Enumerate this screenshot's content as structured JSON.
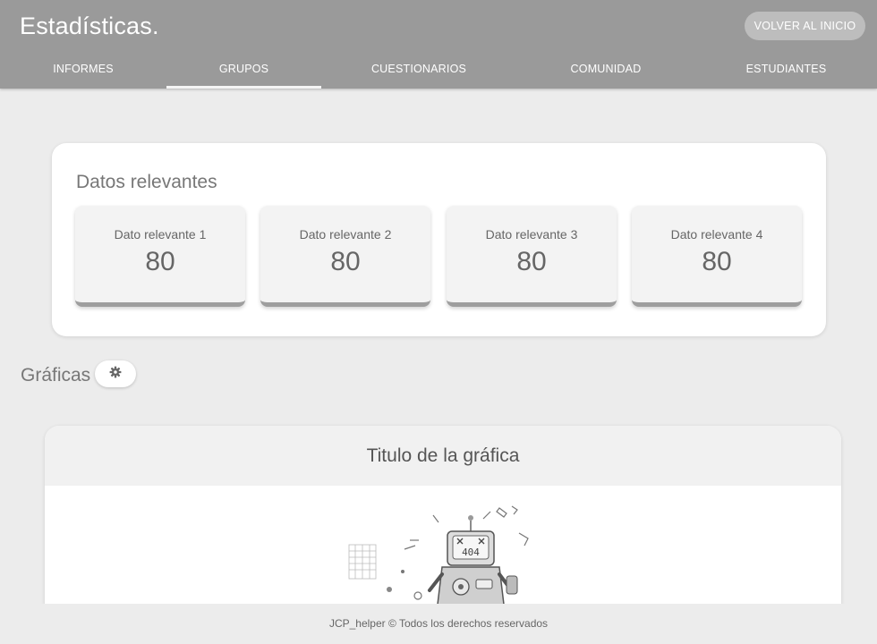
{
  "header": {
    "title": "Estadísticas.",
    "home_button": "VOLVER AL INICIO",
    "tabs": [
      {
        "label": "INFORMES"
      },
      {
        "label": "GRUPOS"
      },
      {
        "label": "CUESTIONARIOS"
      },
      {
        "label": "COMUNIDAD"
      },
      {
        "label": "ESTUDIANTES"
      }
    ],
    "active_tab": "GRUPOS"
  },
  "relevant": {
    "title": "Datos relevantes",
    "stats": [
      {
        "label": "Dato relevante 1",
        "value": "80"
      },
      {
        "label": "Dato relevante 2",
        "value": "80"
      },
      {
        "label": "Dato relevante 3",
        "value": "80"
      },
      {
        "label": "Dato relevante 4",
        "value": "80"
      }
    ]
  },
  "charts": {
    "title": "Gráficas",
    "settings_icon": "gear-icon",
    "card_title": "Titulo de la gráfica",
    "placeholder_screen_text": "404",
    "placeholder_icon": "robot-404-illustration"
  },
  "footer": {
    "text": "JCP_helper © Todos los derechos reservados"
  },
  "colors": {
    "header_bg": "#9a9a9a",
    "page_bg": "#ececec",
    "card_bg": "#ffffff",
    "stat_border": "#9e9e9e"
  }
}
